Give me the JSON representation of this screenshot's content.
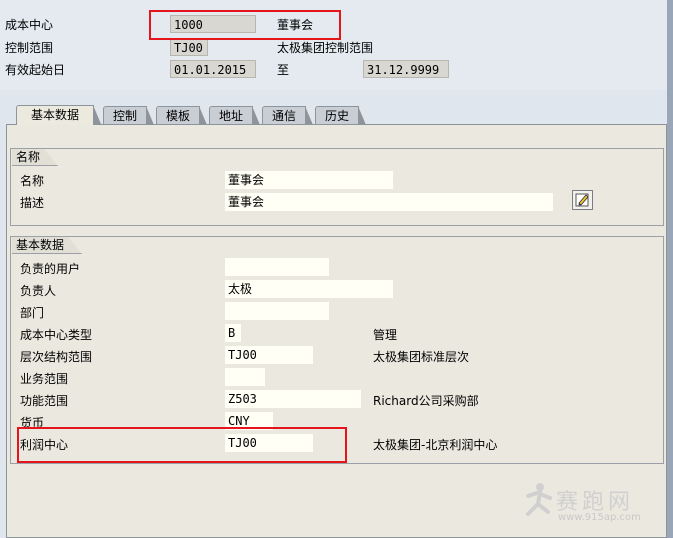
{
  "header": {
    "cost_center_label": "成本中心",
    "cost_center_value": "1000",
    "cost_center_desc": "董事会",
    "controlling_area_label": "控制范围",
    "controlling_area_value": "TJ00",
    "controlling_area_desc": "太极集团控制范围",
    "valid_from_label": "有效起始日",
    "valid_from_value": "01.01.2015",
    "to_label": "至",
    "valid_to_value": "31.12.9999"
  },
  "tabs": [
    {
      "label": "基本数据",
      "active": true
    },
    {
      "label": "控制"
    },
    {
      "label": "模板"
    },
    {
      "label": "地址"
    },
    {
      "label": "通信"
    },
    {
      "label": "历史"
    }
  ],
  "name_group": {
    "title": "名称",
    "name_label": "名称",
    "name_value": "董事会",
    "desc_label": "描述",
    "desc_value": "董事会"
  },
  "basic_group": {
    "title": "基本数据",
    "rows": [
      {
        "label": "负责的用户",
        "value": "",
        "desc": ""
      },
      {
        "label": "负责人",
        "value": "太极",
        "desc": ""
      },
      {
        "label": "部门",
        "value": "",
        "desc": ""
      },
      {
        "label": "成本中心类型",
        "value": "B",
        "desc": "管理"
      },
      {
        "label": "层次结构范围",
        "value": "TJ00",
        "desc": "太极集团标准层次"
      },
      {
        "label": "业务范围",
        "value": "",
        "desc": ""
      },
      {
        "label": "功能范围",
        "value": "Z503",
        "desc": "Richard公司采购部"
      },
      {
        "label": "货币",
        "value": "CNY",
        "desc": ""
      },
      {
        "label": "利润中心",
        "value": "TJ00",
        "desc": "太极集团-北京利润中心"
      }
    ]
  },
  "watermark": {
    "brand": "赛跑网",
    "url": "www.915ap.com"
  },
  "colors": {
    "highlight": "#e4151b"
  },
  "icons": {
    "edit": "pencil-edit-icon"
  }
}
